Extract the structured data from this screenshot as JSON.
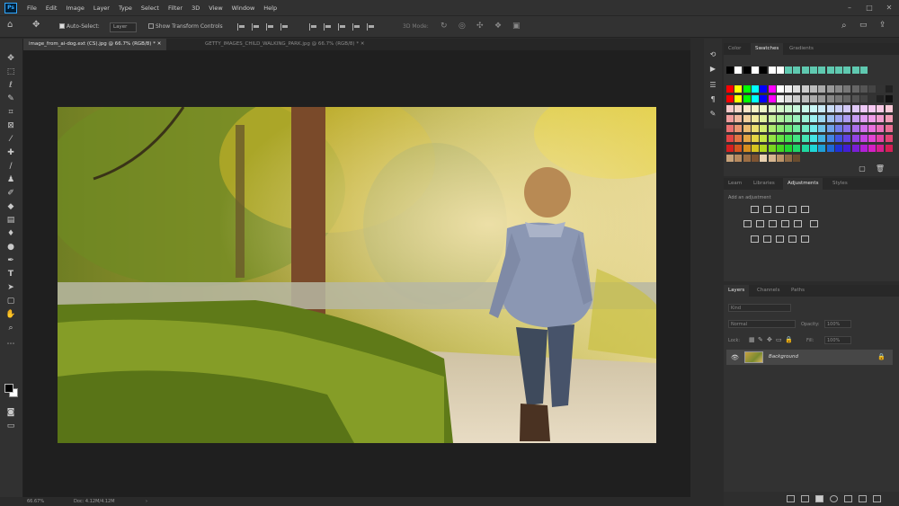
{
  "menu": {
    "logo": "Ps",
    "items": [
      "File",
      "Edit",
      "Image",
      "Layer",
      "Type",
      "Select",
      "Filter",
      "3D",
      "View",
      "Window",
      "Help"
    ],
    "window_controls": [
      "–",
      "□",
      "✕"
    ]
  },
  "options": {
    "auto_select_label": "Auto-Select:",
    "auto_select_value": "Layer",
    "transform_label": "Show Transform Controls",
    "mode_3d": "3D Mode:"
  },
  "document_tabs": [
    {
      "label": "image_from_ai-dog.ext (CS).jpg @ 66.7% (RGB/8) *"
    },
    {
      "label": "GETTY_IMAGES_CHILD_WALKING_PARK.jpg @ 66.7% (RGB/8) *"
    }
  ],
  "status": {
    "zoom": "66.67%",
    "doc_info": "Doc: 4.12M/4.12M"
  },
  "panels": {
    "swatches_tabs": [
      "Color",
      "Swatches",
      "Gradients"
    ],
    "adjust_tabs": [
      "Learn",
      "Libraries",
      "Adjustments",
      "Styles"
    ],
    "adjust_label": "Add an adjustment",
    "layers_tabs": [
      "Layers",
      "Channels",
      "Paths"
    ],
    "layers": {
      "kind": "Kind",
      "blend": "Normal",
      "opacity_label": "Opacity:",
      "opacity": "100%",
      "lock_label": "Lock:",
      "fill_label": "Fill:",
      "fill": "100%",
      "layer_name": "Background"
    }
  },
  "colors": {
    "accent": "#31a8ff",
    "panel_bg": "#323232",
    "workspace_bg": "#1f1f1f"
  },
  "icons": {
    "tools": [
      "move-icon",
      "marquee-icon",
      "lasso-icon",
      "quick-select-icon",
      "crop-icon",
      "frame-icon",
      "eyedropper-icon",
      "spot-heal-icon",
      "brush-icon",
      "stamp-icon",
      "history-brush-icon",
      "eraser-icon",
      "gradient-icon",
      "blur-icon",
      "dodge-icon",
      "pen-icon",
      "type-icon",
      "path-select-icon",
      "rectangle-icon",
      "hand-icon",
      "zoom-icon",
      "more-icon"
    ]
  }
}
